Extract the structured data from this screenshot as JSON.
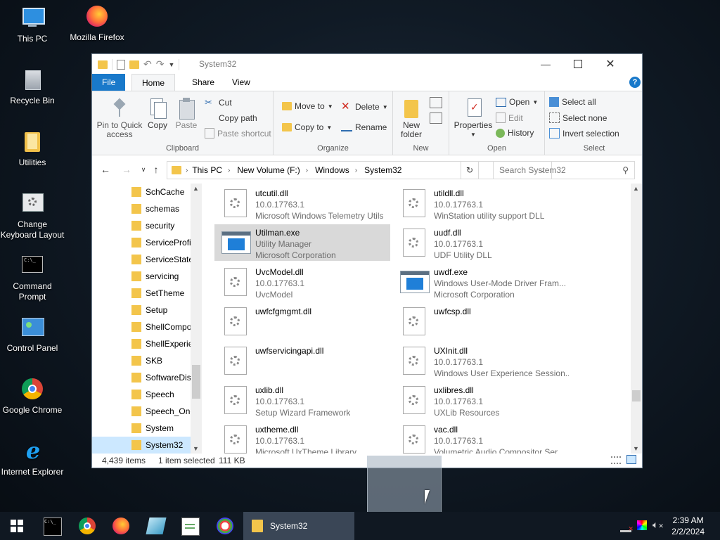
{
  "desktop": {
    "icons": [
      {
        "label": "This PC"
      },
      {
        "label": "Mozilla Firefox"
      },
      {
        "label": "Recycle Bin"
      },
      {
        "label": "Utilities"
      },
      {
        "label": "Change Keyboard Layout"
      },
      {
        "label": "Command Prompt"
      },
      {
        "label": "Control Panel"
      },
      {
        "label": "Google Chrome"
      },
      {
        "label": "Internet Explorer"
      }
    ]
  },
  "window": {
    "title": "System32",
    "tabs": [
      "File",
      "Home",
      "Share",
      "View"
    ],
    "ribbon": {
      "clipboard": {
        "label": "Clipboard",
        "pin": "Pin to Quick access",
        "copy": "Copy",
        "paste": "Paste",
        "cut": "Cut",
        "copy_path": "Copy path",
        "paste_shortcut": "Paste shortcut"
      },
      "organize": {
        "label": "Organize",
        "move_to": "Move to",
        "copy_to": "Copy to",
        "delete": "Delete",
        "rename": "Rename"
      },
      "new": {
        "label": "New",
        "new_folder": "New folder"
      },
      "open": {
        "label": "Open",
        "properties": "Properties",
        "open": "Open",
        "edit": "Edit",
        "history": "History"
      },
      "select": {
        "label": "Select",
        "select_all": "Select all",
        "select_none": "Select none",
        "invert": "Invert selection"
      }
    },
    "address": {
      "crumbs": [
        "This PC",
        "New Volume (F:)",
        "Windows",
        "System32"
      ],
      "search_placeholder": "Search System32"
    },
    "navpane": {
      "items": [
        "SchCache",
        "schemas",
        "security",
        "ServiceProfi",
        "ServiceState",
        "servicing",
        "SetTheme",
        "Setup",
        "ShellCompo",
        "ShellExperie",
        "SKB",
        "SoftwareDis",
        "Speech",
        "Speech_One",
        "System",
        "System32"
      ],
      "selected": "System32"
    },
    "files": [
      {
        "name": "utcutil.dll",
        "line2": "10.0.17763.1",
        "line3": "Microsoft Windows Telemetry Utils",
        "icon": "dll-icon"
      },
      {
        "name": "utildll.dll",
        "line2": "10.0.17763.1",
        "line3": "WinStation utility support DLL",
        "icon": "dll-icon"
      },
      {
        "name": "Utilman.exe",
        "line2": "Utility Manager",
        "line3": "Microsoft Corporation",
        "icon": "exe-icon",
        "selected": true
      },
      {
        "name": "uudf.dll",
        "line2": "10.0.17763.1",
        "line3": "UDF Utility DLL",
        "icon": "dll-icon"
      },
      {
        "name": "UvcModel.dll",
        "line2": "10.0.17763.1",
        "line3": "UvcModel",
        "icon": "dll-icon"
      },
      {
        "name": "uwdf.exe",
        "line2": "Windows User-Mode Driver Fram...",
        "line3": "Microsoft Corporation",
        "icon": "exe-icon"
      },
      {
        "name": "uwfcfgmgmt.dll",
        "line2": "",
        "line3": "",
        "icon": "dll-icon"
      },
      {
        "name": "uwfcsp.dll",
        "line2": "",
        "line3": "",
        "icon": "dll-icon"
      },
      {
        "name": "uwfservicingapi.dll",
        "line2": "",
        "line3": "",
        "icon": "dll-icon"
      },
      {
        "name": "UXInit.dll",
        "line2": "10.0.17763.1",
        "line3": "Windows User Experience Session...",
        "icon": "dll-icon"
      },
      {
        "name": "uxlib.dll",
        "line2": "10.0.17763.1",
        "line3": "Setup Wizard Framework",
        "icon": "dll-icon"
      },
      {
        "name": "uxlibres.dll",
        "line2": "10.0.17763.1",
        "line3": "UXLib Resources",
        "icon": "dll-icon"
      },
      {
        "name": "uxtheme.dll",
        "line2": "10.0.17763.1",
        "line3": "Microsoft UxTheme Library",
        "icon": "dll-icon"
      },
      {
        "name": "vac.dll",
        "line2": "10.0.17763.1",
        "line3": "Volumetric Audio Compositor Ser...",
        "icon": "dll-icon"
      }
    ],
    "status": {
      "count": "4,439 items",
      "selection": "1 item selected",
      "size": "111 KB"
    }
  },
  "taskbar": {
    "active_item": "System32",
    "time": "2:39 AM",
    "date": "2/2/2024"
  },
  "colors": {
    "accent": "#1979ca",
    "selection": "#cce8ff",
    "taskbar": "#101822",
    "folder": "#f3c54b"
  }
}
